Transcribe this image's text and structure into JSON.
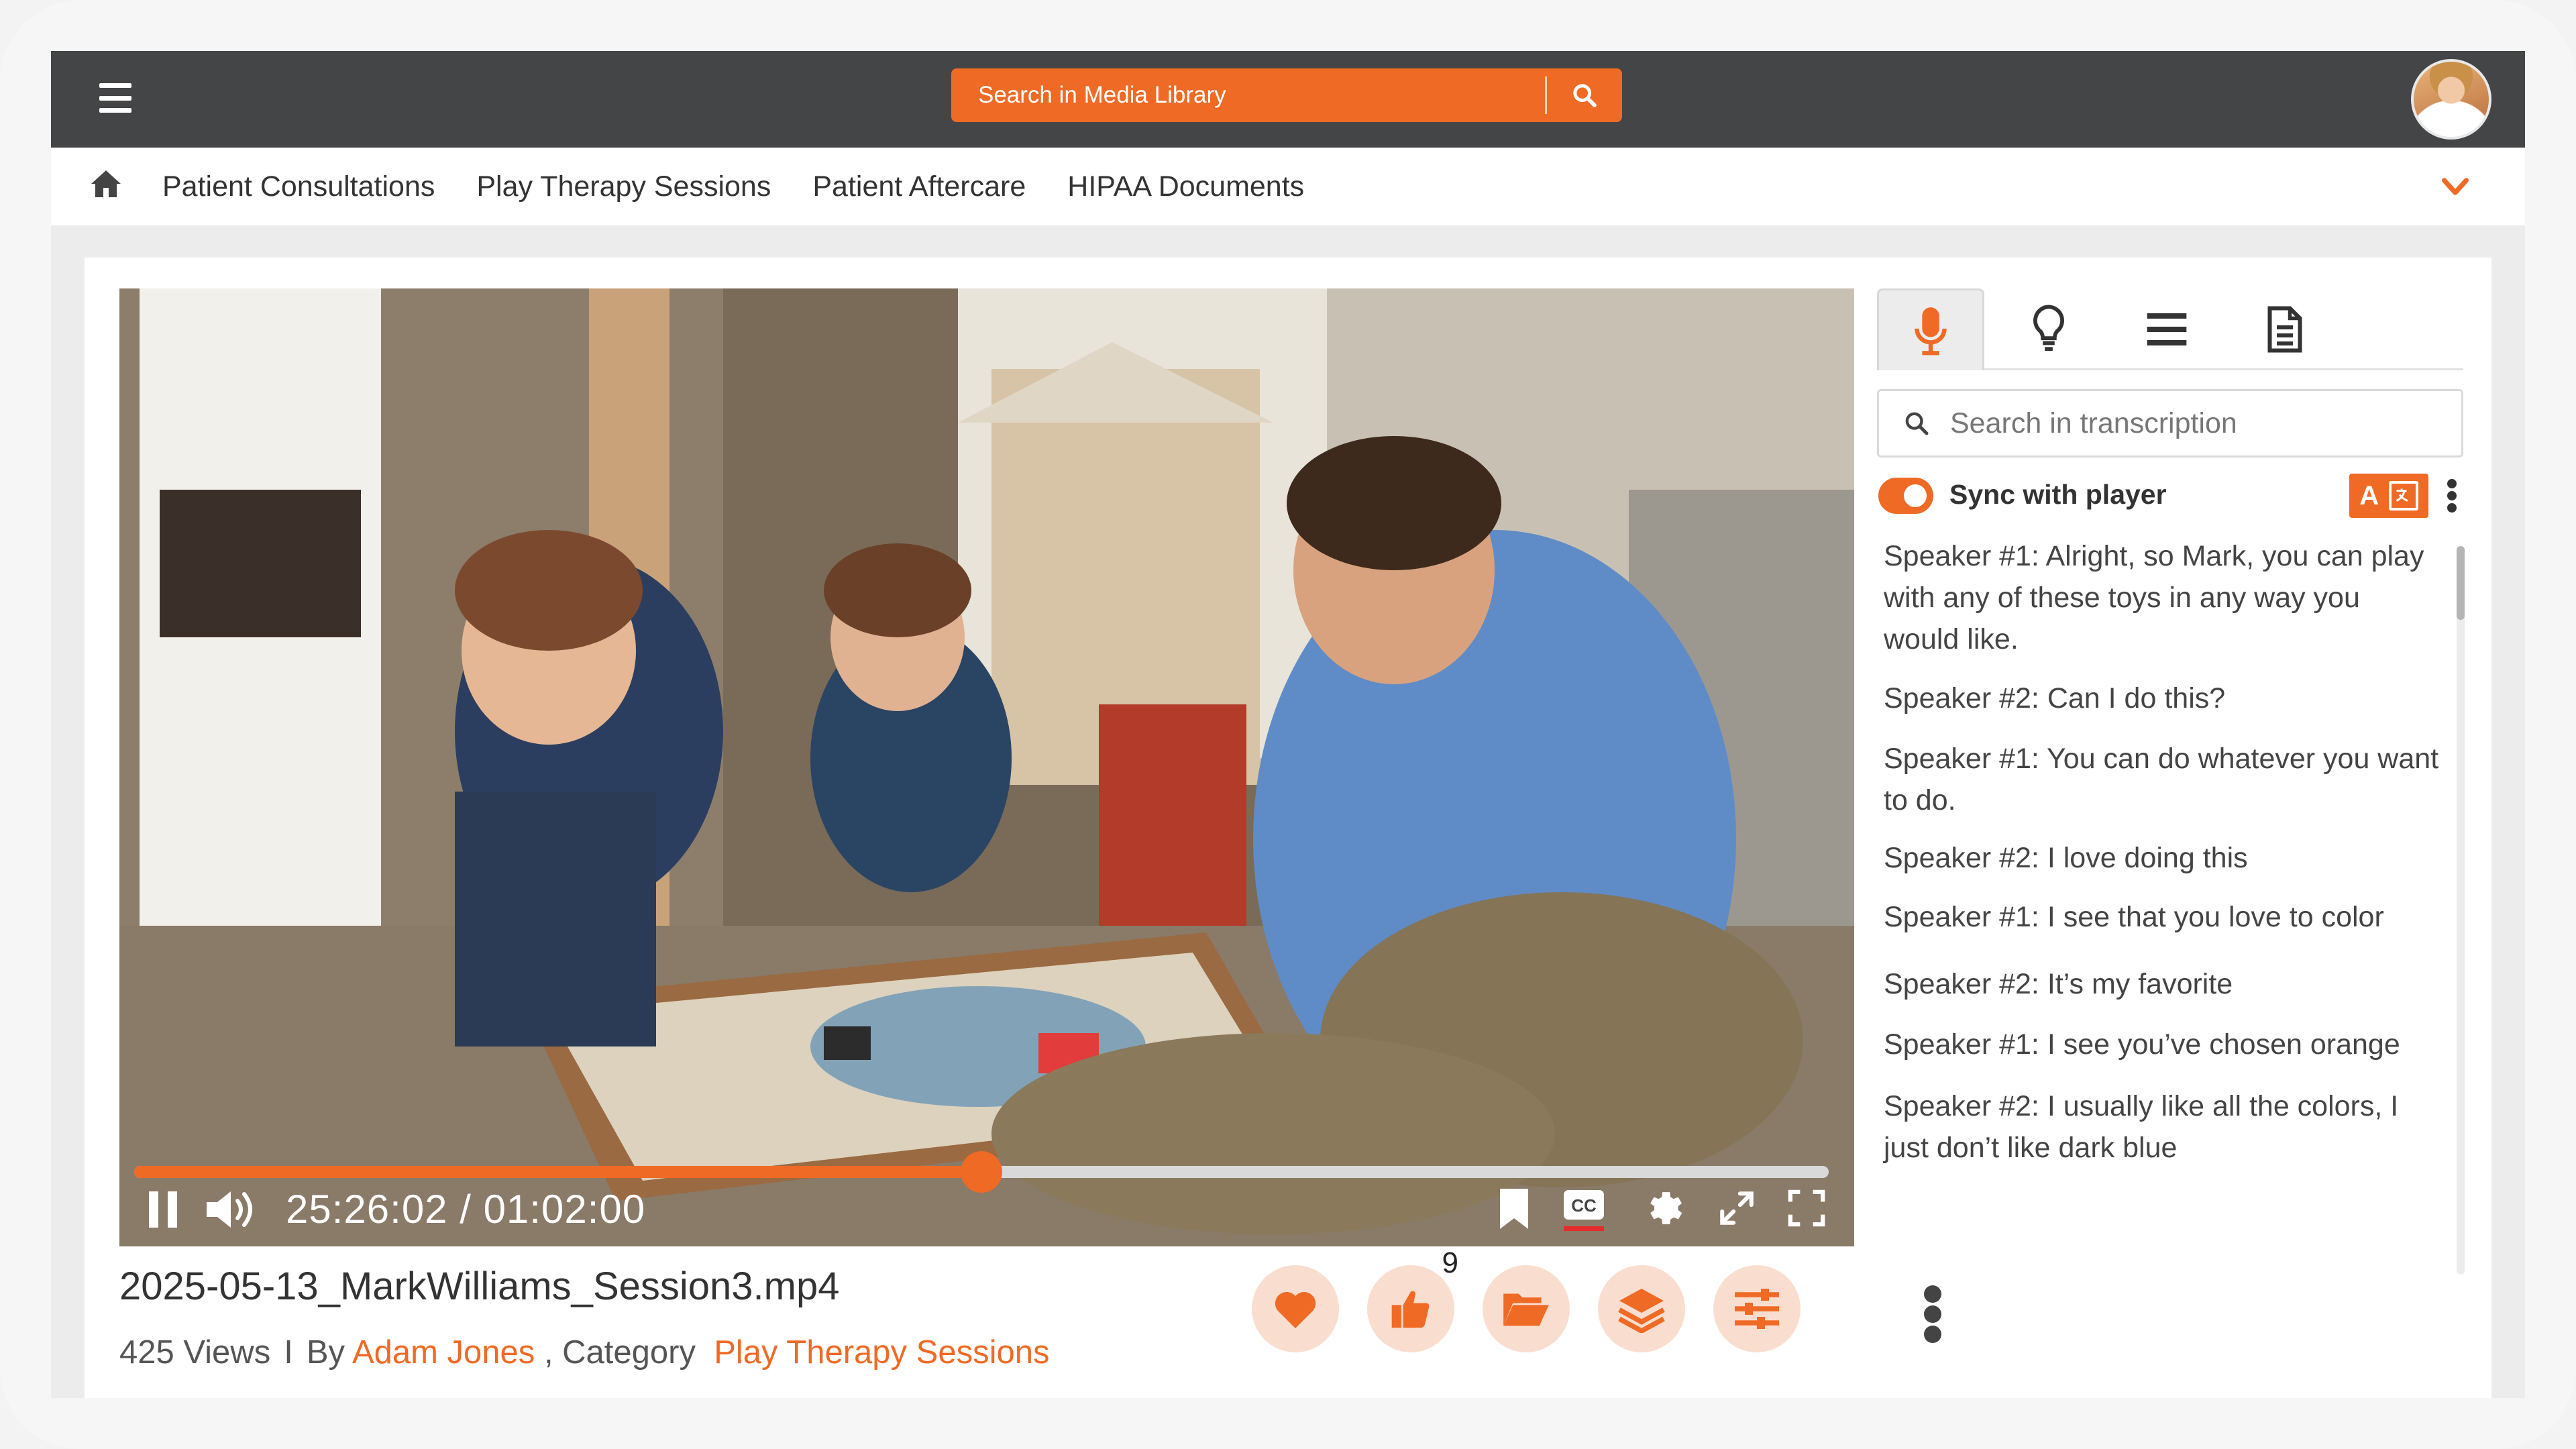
{
  "header": {
    "search_placeholder": "Search in Media Library"
  },
  "nav": {
    "links": [
      "Patient Consultations",
      "Play Therapy Sessions",
      "Patient Aftercare",
      "HIPAA Documents"
    ]
  },
  "player": {
    "time": "25:26:02 / 01:02:00",
    "progress_fraction": 0.5
  },
  "video": {
    "title": "2025-05-13_MarkWilliams_Session3.mp4",
    "views": "425 Views",
    "separator": "I",
    "by_label": "By",
    "author": "Adam Jones",
    "category_label": ", Category",
    "category": "Play Therapy Sessions",
    "like_count": "9"
  },
  "side": {
    "search_placeholder": "Search in transcription",
    "sync_label": "Sync with player",
    "sync_on": true,
    "translate_letter": "A",
    "transcript": [
      "Speaker #1: Alright, so Mark, you can play with any of these toys in any way you would like.",
      "Speaker #2: Can I do this?",
      "Speaker #1: You can do whatever you want to do.",
      "Speaker #2: I love doing this",
      "Speaker #1: I see that you love to color",
      "Speaker #2: It’s my favorite",
      "Speaker #1: I see you’ve chosen orange",
      "Speaker #2: I usually like all the colors, I just don’t like dark blue"
    ]
  },
  "colors": {
    "accent": "#ef6a25",
    "topbar": "#444547",
    "accent_light": "#f9ded0"
  },
  "icons": [
    "menu-icon",
    "search-icon",
    "home-icon",
    "chevron-down-icon",
    "pause-icon",
    "volume-icon",
    "bookmark-icon",
    "cc-icon",
    "settings-icon",
    "expand-icon",
    "fullscreen-icon",
    "heart-icon",
    "thumbs-up-icon",
    "folder-icon",
    "layers-icon",
    "sliders-icon",
    "microphone-icon",
    "lightbulb-icon",
    "list-icon",
    "document-icon",
    "translate-icon"
  ]
}
